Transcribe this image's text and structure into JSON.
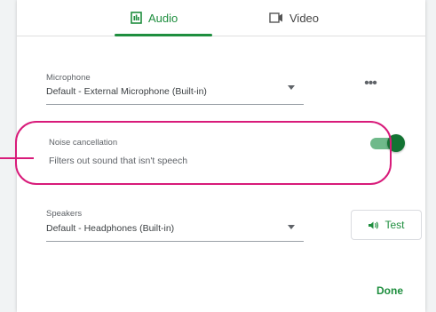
{
  "tabs": [
    {
      "label": "Audio",
      "icon": "audio-icon",
      "selected": true
    },
    {
      "label": "Video",
      "icon": "video-icon",
      "selected": false
    }
  ],
  "microphone": {
    "label": "Microphone",
    "value": "Default - External Microphone (Built-in)",
    "more_icon": "more-horiz-icon"
  },
  "noise_cancellation": {
    "title": "Noise cancellation",
    "description": "Filters out sound that isn't speech",
    "enabled": true
  },
  "speakers": {
    "label": "Speakers",
    "value": "Default - Headphones (Built-in)",
    "test_label": "Test",
    "test_icon": "speaker-icon"
  },
  "done_label": "Done",
  "colors": {
    "accent_green": "#1e8e3e",
    "highlight_magenta": "#d81b7a",
    "toggle_track": "#6fb98a"
  }
}
